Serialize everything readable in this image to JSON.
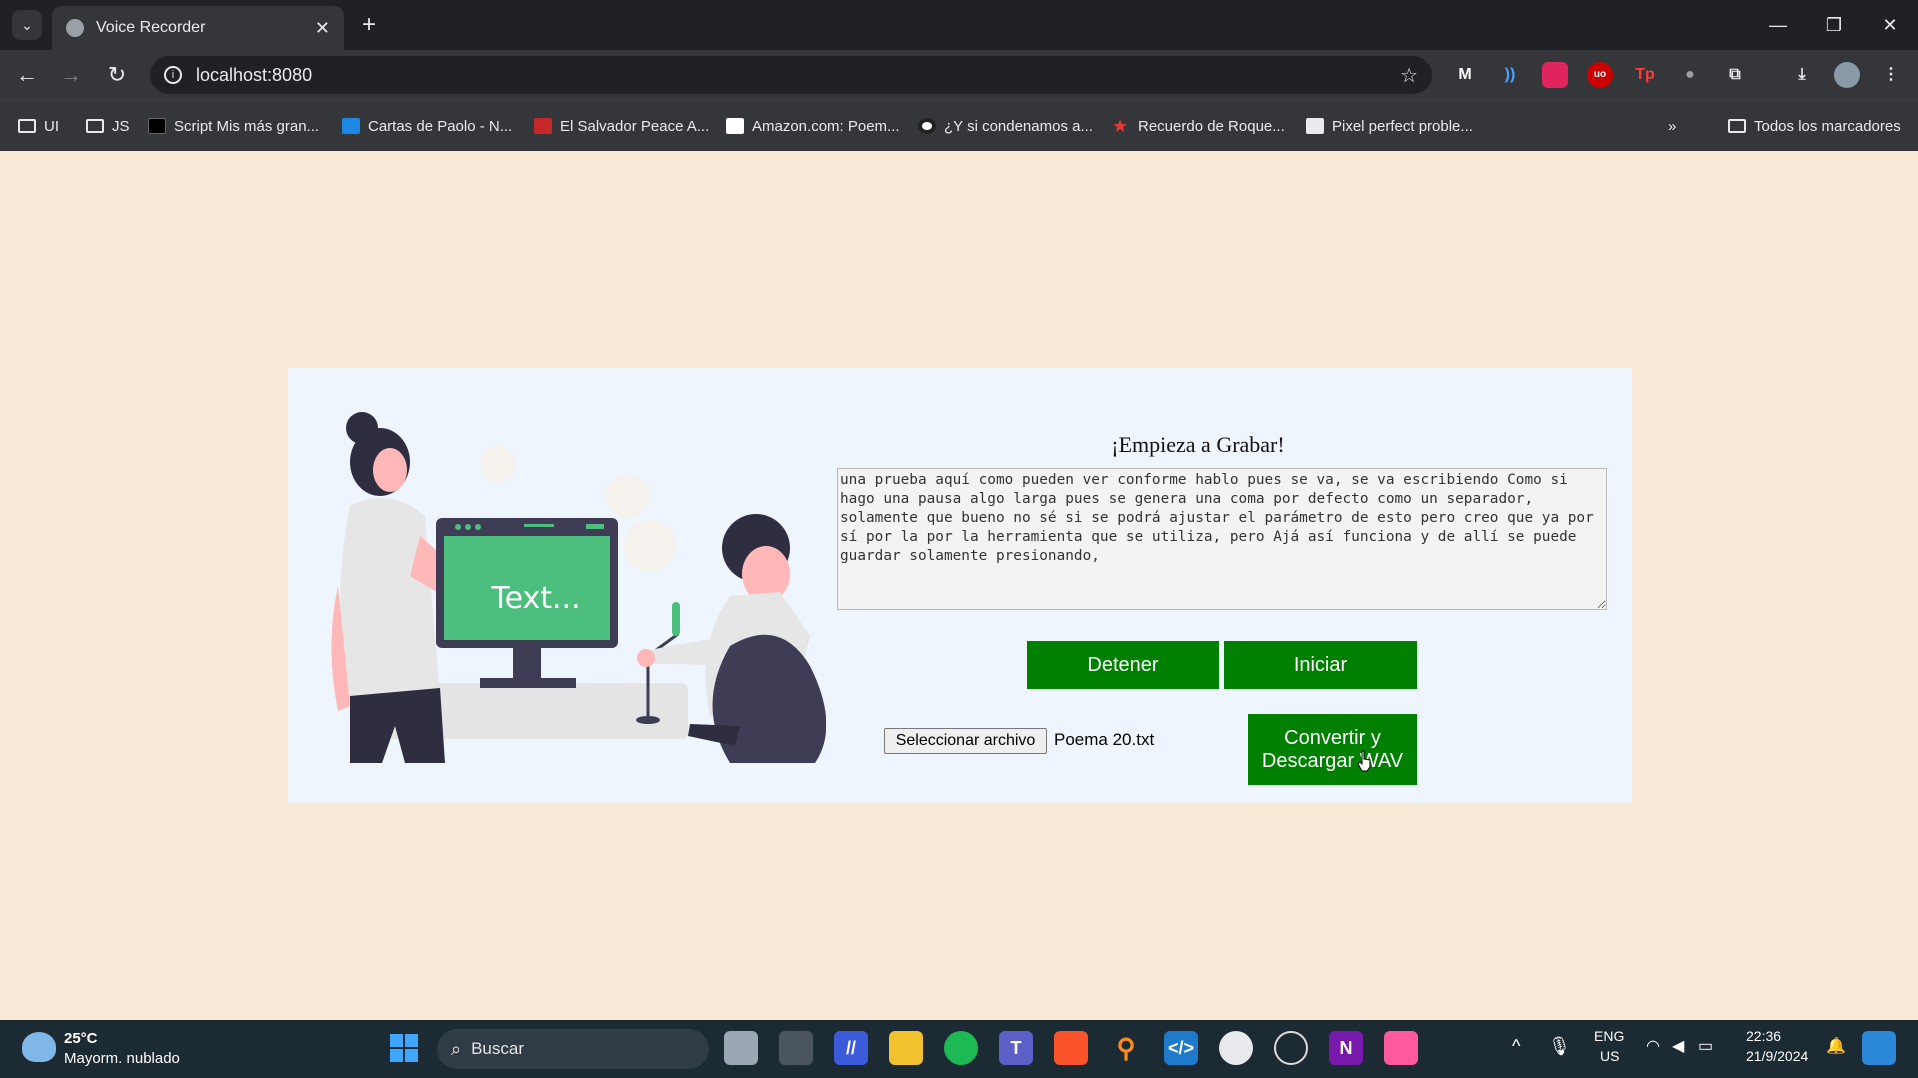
{
  "browser": {
    "tab_title": "Voice Recorder",
    "url": "localhost:8080",
    "bookmarks": [
      {
        "label": "UI"
      },
      {
        "label": "JS"
      },
      {
        "label": "Script Mis más gran..."
      },
      {
        "label": "Cartas de Paolo - N..."
      },
      {
        "label": "El Salvador Peace A..."
      },
      {
        "label": "Amazon.com: Poem..."
      },
      {
        "label": "¿Y si condenamos a..."
      },
      {
        "label": "Recuerdo de Roque..."
      },
      {
        "label": "Pixel perfect proble..."
      }
    ],
    "all_bookmarks": "Todos los marcadores"
  },
  "app": {
    "heading": "¡Empieza a Grabar!",
    "transcript": "una prueba aquí como pueden ver conforme hablo pues se va, se va escribiendo Como si hago una pausa algo larga pues se genera una coma por defecto como un separador, solamente que bueno no sé si se podrá ajustar el parámetro de esto pero creo que ya por sí por la por la herramienta que se utiliza, pero Ajá así funciona y de allí se puede guardar solamente presionando,",
    "stop_label": "Detener",
    "start_label": "Iniciar",
    "file_button_label": "Seleccionar archivo",
    "file_name": "Poema 20.txt",
    "convert_label_1": "Convertir y",
    "convert_label_2": "Descargar WAV",
    "illustration_text": "Text..."
  },
  "taskbar": {
    "weather_temp": "25°C",
    "weather_desc": "Mayorm. nublado",
    "search_placeholder": "Buscar",
    "lang_1": "ENG",
    "lang_2": "US",
    "time": "22:36",
    "date": "21/9/2024"
  },
  "colors": {
    "page_bg": "#f9ead7",
    "card_bg": "#eef5fc",
    "button_green": "#008000",
    "illus_green": "#4cbf7e"
  }
}
